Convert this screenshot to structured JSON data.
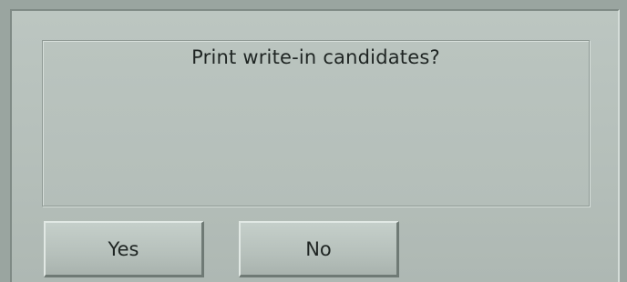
{
  "dialog": {
    "message": "Print write-in candidates?"
  },
  "buttons": {
    "yes_label": "Yes",
    "no_label": "No"
  }
}
